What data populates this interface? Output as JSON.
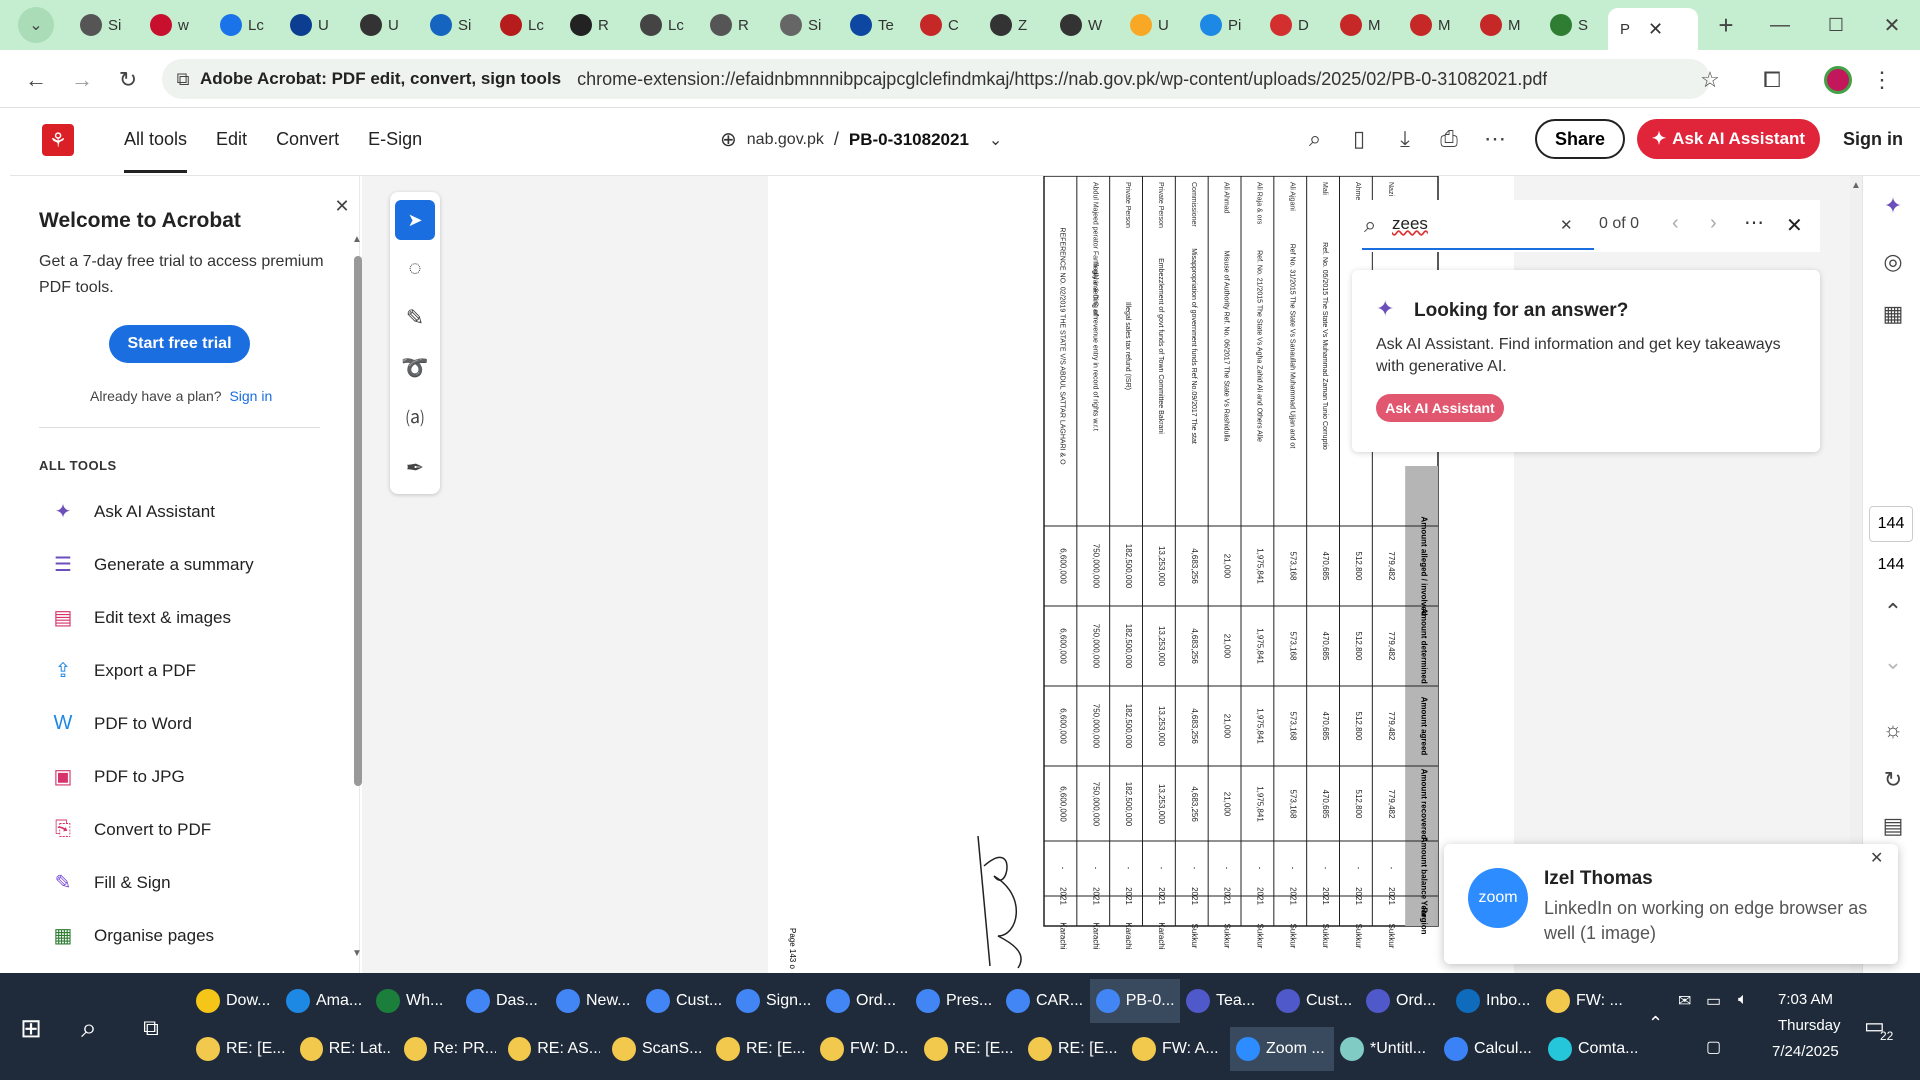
{
  "browser": {
    "tabs": [
      {
        "label": "Si",
        "color": "#555"
      },
      {
        "label": "w",
        "color": "#c8102e"
      },
      {
        "label": "Lc",
        "color": "#1a73e8"
      },
      {
        "label": "U",
        "color": "#0b3d91"
      },
      {
        "label": "U",
        "color": "#333"
      },
      {
        "label": "Si",
        "color": "#1565c0"
      },
      {
        "label": "Lc",
        "color": "#b71c1c"
      },
      {
        "label": "R",
        "color": "#222"
      },
      {
        "label": "Lc",
        "color": "#444"
      },
      {
        "label": "R",
        "color": "#555"
      },
      {
        "label": "Si",
        "color": "#666"
      },
      {
        "label": "Te",
        "color": "#0d47a1"
      },
      {
        "label": "C",
        "color": "#c62828"
      },
      {
        "label": "Z",
        "color": "#333"
      },
      {
        "label": "W",
        "color": "#333"
      },
      {
        "label": "U",
        "color": "#f9a825"
      },
      {
        "label": "Pi",
        "color": "#1e88e5"
      },
      {
        "label": "D",
        "color": "#d32f2f"
      },
      {
        "label": "M",
        "color": "#c62828"
      },
      {
        "label": "M",
        "color": "#c62828"
      },
      {
        "label": "M",
        "color": "#c62828"
      },
      {
        "label": "S",
        "color": "#2e7d32"
      }
    ],
    "active_tab": "P",
    "site_label": "Adobe Acrobat: PDF edit, convert, sign tools",
    "url": "chrome-extension://efaidnbmnnnibpcajpcglclefindmkaj/https://nab.gov.pk/wp-content/uploads/2025/02/PB-0-31082021.pdf"
  },
  "acrobat": {
    "nav": [
      "All tools",
      "Edit",
      "Convert",
      "E-Sign"
    ],
    "breadcrumb_domain": "nab.gov.pk",
    "breadcrumb_sep": "/",
    "file_name": "PB-0-31082021",
    "share_label": "Share",
    "ask_ai_label": "Ask AI Assistant",
    "sign_in_label": "Sign in"
  },
  "welcome": {
    "title": "Welcome to Acrobat",
    "desc": "Get a 7-day free trial to access premium PDF tools.",
    "trial_btn": "Start free trial",
    "have_plan": "Already have a plan?",
    "sign_in": "Sign in",
    "all_tools": "ALL TOOLS",
    "tools": [
      {
        "label": "Ask AI Assistant",
        "icon": "ai-assistant-icon",
        "glyph": "✦",
        "color": "#6b4fbb"
      },
      {
        "label": "Generate a summary",
        "icon": "summary-icon",
        "glyph": "☰",
        "color": "#6b4fbb"
      },
      {
        "label": "Edit text & images",
        "icon": "edit-icon",
        "glyph": "▤",
        "color": "#d6336c"
      },
      {
        "label": "Export a PDF",
        "icon": "export-icon",
        "glyph": "⇪",
        "color": "#1e88e5"
      },
      {
        "label": "PDF to Word",
        "icon": "pdf-word-icon",
        "glyph": "W",
        "color": "#1e88e5"
      },
      {
        "label": "PDF to JPG",
        "icon": "pdf-jpg-icon",
        "glyph": "▣",
        "color": "#d6336c"
      },
      {
        "label": "Convert to PDF",
        "icon": "convert-icon",
        "glyph": "⎘",
        "color": "#d6336c"
      },
      {
        "label": "Fill & Sign",
        "icon": "fill-sign-icon",
        "glyph": "✎",
        "color": "#7b4fd8"
      },
      {
        "label": "Organise pages",
        "icon": "organise-icon",
        "glyph": "▦",
        "color": "#2e7d32"
      }
    ]
  },
  "search": {
    "query": "zees",
    "count": "0 of 0",
    "ai_title": "Looking for an answer?",
    "ai_desc": "Ask AI Assistant. Find information and get key takeaways with generative AI.",
    "ai_btn": "Ask AI Assistant"
  },
  "page_num": {
    "current": "144",
    "total": "144"
  },
  "notification": {
    "app": "zoom",
    "name": "Izel Thomas",
    "message": "LinkedIn on working on edge browser as well (1 image)"
  },
  "pdf_table": {
    "side_label": "Page 143 o",
    "header_cells": [
      "Amount alleged / involved",
      "Amount determined",
      "Amount agreed",
      "Amount recovered",
      "Amount balance",
      "Year",
      "Region"
    ],
    "rows": [
      {
        "desc": "and ors.Allegation",
        "v1": "779,482",
        "v2": "779,482",
        "v3": "779,482",
        "v4": "779,482",
        "bal": "-",
        "year": "2021",
        "region": "Sukkur"
      },
      {
        "desc": "others Allegation Illegal Appointments",
        "v1": "512,800",
        "v2": "512,800",
        "v3": "512,800",
        "v4": "512,800",
        "bal": "-",
        "year": "2021",
        "region": "Sukkur"
      },
      {
        "desc": "Ref. No. 05/2015 The State Vs Muhammad Zaman Tunio Corruption and Corrupt practices and Assets beyond known sources of income",
        "v1": "470,685",
        "v2": "470,685",
        "v3": "470,685",
        "v4": "470,685",
        "bal": "-",
        "year": "2021",
        "region": "Sukkur"
      },
      {
        "desc": "Ref No. 31/2015 The State Vs Sanaullah Muhammad Ujjan and others Allegation Embezzlement of GP funds",
        "v1": "573,168",
        "v2": "573,168",
        "v3": "573,168",
        "v4": "573,168",
        "bal": "-",
        "year": "2021",
        "region": "Sukkur"
      },
      {
        "desc": "Ref. No. 21/2015 The State Vs Agha Zahid Ali and Others Allegation Embezzlement of Govt funds",
        "v1": "1,975,841",
        "v2": "1,975,841",
        "v3": "1,975,841",
        "v4": "1,975,841",
        "bal": "-",
        "year": "2021",
        "region": "Sukkur"
      },
      {
        "desc": "Misuse of Authority Ref. No. 06/2017 The State Vs Rashidullah Pirzado and others Allegation",
        "v1": "21,000",
        "v2": "21,000",
        "v3": "21,000",
        "v4": "21,000",
        "bal": "-",
        "year": "2021",
        "region": "Sukkur"
      },
      {
        "desc": "Misappropriation of government funds Ref No.09/2017 The state vs Masood Ahmed and others Allegation",
        "v1": "4,683,256",
        "v2": "4,683,256",
        "v3": "4,683,256",
        "v4": "4,683,256",
        "bal": "-",
        "year": "2021",
        "region": "Sukkur"
      },
      {
        "desc": "Embezzlement of govt funds of Town Committee Bakrani",
        "v1": "13,253,000",
        "v2": "13,253,000",
        "v3": "13,253,000",
        "v4": "13,253,000",
        "bal": "-",
        "year": "2021",
        "region": "Karachi"
      },
      {
        "desc": "Illegal sales tax refund (ISR)",
        "v1": "182,500,000",
        "v2": "182,500,000",
        "v3": "182,500,000",
        "v4": "182,500,000",
        "bal": "-",
        "year": "2021",
        "region": "Karachi"
      },
      {
        "desc": "Illegal inserting of revenue entry in record of rights w.r.t State land",
        "v1": "750,000,000",
        "v2": "750,000,000",
        "v3": "750,000,000",
        "v4": "750,000,000",
        "bal": "-",
        "year": "2021",
        "region": "Karachi"
      },
      {
        "desc": "REFERENCE NO. 02/2019 THE STATE V/S ABDUL SATTAR LAGHARI & OTHERS. Abdul Sattar Laghari, ex-Dep Liquidator Cooperative Farm Service Center Tando Allahyar sold agricultural land admeasuring 2.8 acres in dubious manner for Rs.10 million to Batan Lal S/o Dhalu Mal",
        "v1": "6,600,000",
        "v2": "6,600,000",
        "v3": "6,600,000",
        "v4": "6,600,000",
        "bal": "-",
        "year": "2021",
        "region": "Karachi"
      }
    ],
    "left_labels": [
      "Nazi",
      "Ahmed",
      "Mali",
      "Ali Ajgani",
      "Ali Raja & ors",
      "Ali Ahmad",
      "Commissioner",
      "Private Person",
      "Private Person",
      "Abdul Majeed perator Farm allyar & D.G arh"
    ]
  },
  "taskbar": {
    "row1": [
      {
        "label": "Dow...",
        "color": "#f5c518"
      },
      {
        "label": "Ama...",
        "color": "#1e88e5"
      },
      {
        "label": "Wh...",
        "color": "#1b7f3b"
      },
      {
        "label": "Das...",
        "color": "#4285f4"
      },
      {
        "label": "New...",
        "color": "#4285f4"
      },
      {
        "label": "Cust...",
        "color": "#4285f4"
      },
      {
        "label": "Sign...",
        "color": "#4285f4"
      },
      {
        "label": "Ord...",
        "color": "#4285f4"
      },
      {
        "label": "Pres...",
        "color": "#4285f4"
      },
      {
        "label": "CAR...",
        "color": "#4285f4"
      },
      {
        "label": "PB-0...",
        "color": "#4285f4"
      },
      {
        "label": "Tea...",
        "color": "#5059c9"
      },
      {
        "label": "Cust...",
        "color": "#5059c9"
      },
      {
        "label": "Ord...",
        "color": "#5059c9"
      },
      {
        "label": "Inbo...",
        "color": "#0f6cbd"
      },
      {
        "label": "FW: ...",
        "color": "#f2c94c"
      }
    ],
    "row2": [
      {
        "label": "RE: [E...",
        "color": "#f2c94c"
      },
      {
        "label": "RE: Lat...",
        "color": "#f2c94c"
      },
      {
        "label": "Re: PR...",
        "color": "#f2c94c"
      },
      {
        "label": "RE: AS...",
        "color": "#f2c94c"
      },
      {
        "label": "ScanS...",
        "color": "#f2c94c"
      },
      {
        "label": "RE: [E...",
        "color": "#f2c94c"
      },
      {
        "label": "FW: D...",
        "color": "#f2c94c"
      },
      {
        "label": "RE: [E...",
        "color": "#f2c94c"
      },
      {
        "label": "RE: [E...",
        "color": "#f2c94c"
      },
      {
        "label": "FW: A...",
        "color": "#f2c94c"
      },
      {
        "label": "Zoom ...",
        "color": "#2d8cff"
      },
      {
        "label": "*Untitl...",
        "color": "#80cbc4"
      },
      {
        "label": "Calcul...",
        "color": "#3b82f6"
      },
      {
        "label": "Comta...",
        "color": "#26c6da"
      }
    ],
    "time": "7:03 AM",
    "day": "Thursday",
    "date": "7/24/2025",
    "notif_count": "22"
  }
}
